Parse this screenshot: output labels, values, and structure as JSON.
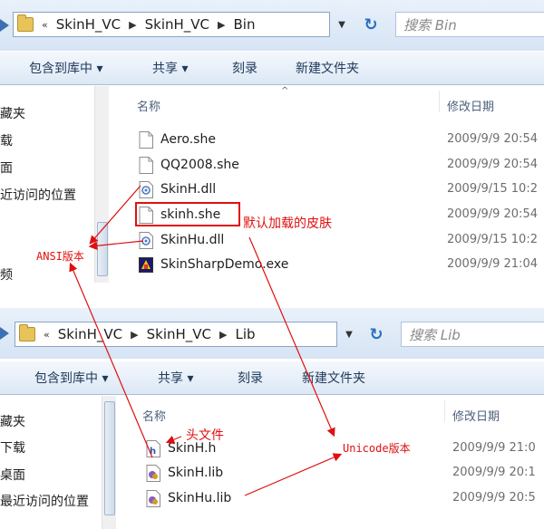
{
  "window_top": {
    "breadcrumbs": [
      "SkinH_VC",
      "SkinH_VC",
      "Bin"
    ],
    "chevrons": "«",
    "search_placeholder": "搜索 Bin",
    "toolbar": [
      "包含到库中 ▾",
      "共享 ▾",
      "刻录",
      "新建文件夹"
    ],
    "nav_items": [
      "藏夹",
      "载",
      "面",
      "近访问的位置",
      "频"
    ],
    "columns": {
      "name": "名称",
      "date": "修改日期"
    },
    "files": [
      {
        "name": "Aero.she",
        "date": "2009/9/9 20:54",
        "icon": "file-icon"
      },
      {
        "name": "QQ2008.she",
        "date": "2009/9/9 20:54",
        "icon": "file-icon"
      },
      {
        "name": "SkinH.dll",
        "date": "2009/9/15 10:2",
        "icon": "dll-icon"
      },
      {
        "name": "skinh.she",
        "date": "2009/9/9 20:54",
        "icon": "file-icon"
      },
      {
        "name": "SkinHu.dll",
        "date": "2009/9/15 10:2",
        "icon": "dll-icon"
      },
      {
        "name": "SkinSharpDemo.exe",
        "date": "2009/9/9 21:04",
        "icon": "exe-icon"
      }
    ]
  },
  "window_bottom": {
    "breadcrumbs": [
      "SkinH_VC",
      "SkinH_VC",
      "Lib"
    ],
    "chevrons": "«",
    "search_placeholder": "搜索 Lib",
    "toolbar": [
      "包含到库中 ▾",
      "共享 ▾",
      "刻录",
      "新建文件夹"
    ],
    "nav_items": [
      "藏夹",
      "下载",
      "桌面",
      "最近访问的位置"
    ],
    "columns": {
      "name": "名称",
      "date": "修改日期"
    },
    "files": [
      {
        "name": "SkinH.h",
        "date": "2009/9/9 21:0",
        "icon": "header-file-icon"
      },
      {
        "name": "SkinH.lib",
        "date": "2009/9/9 20:1",
        "icon": "lib-icon"
      },
      {
        "name": "SkinHu.lib",
        "date": "2009/9/9 20:5",
        "icon": "lib-icon"
      }
    ]
  },
  "annotations": {
    "default_skin": "默认加载的皮肤",
    "ansi": "ANSI版本",
    "unicode": "Unicode版本",
    "header_file": "头文件"
  },
  "colors": {
    "annotation": "#e01010",
    "toolbar_text": "#1e395b"
  }
}
